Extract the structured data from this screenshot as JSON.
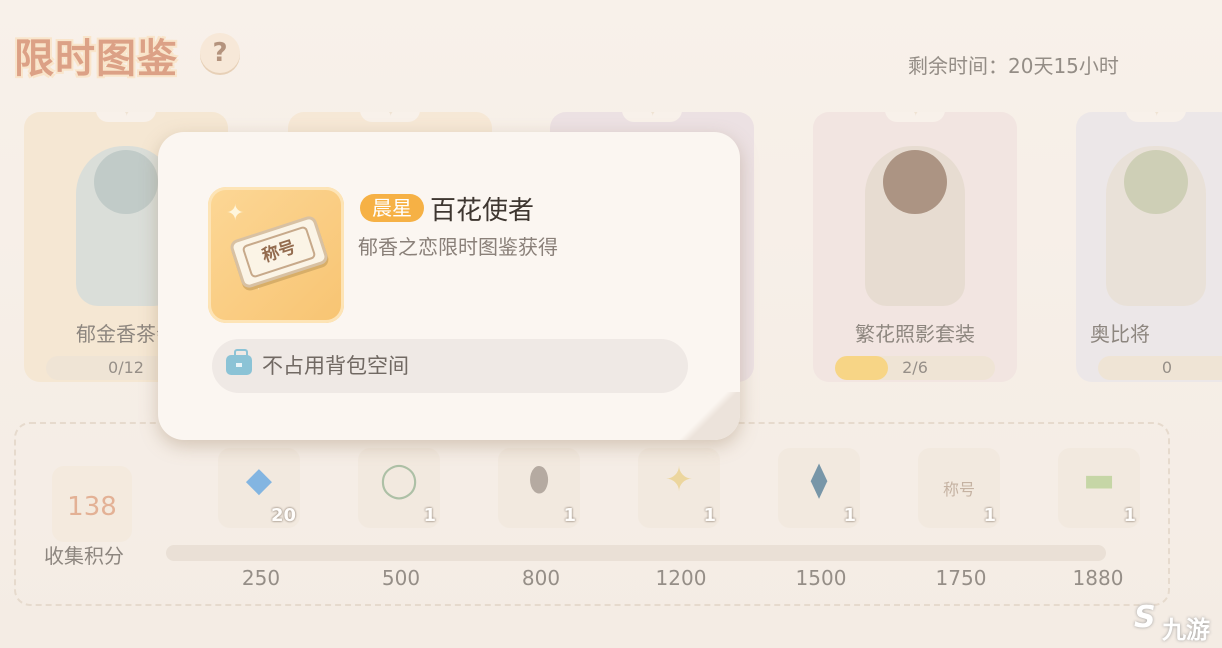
{
  "header": {
    "title": "限时图鉴",
    "help": "?",
    "timer": "剩余时间：20天15小时"
  },
  "cards": [
    {
      "name": "郁金香茶会",
      "progress_text": "0/12",
      "progress": 0
    },
    {
      "name": "",
      "progress_text": "",
      "progress": 0
    },
    {
      "name": "",
      "progress_text": "",
      "progress": 0
    },
    {
      "name": "繁花照影套装",
      "progress_text": "2/6",
      "progress": 0.333
    },
    {
      "name": "奥比将",
      "progress_text": "0",
      "progress": 0
    }
  ],
  "collection": {
    "score": "138",
    "score_label": "收集积分",
    "milestones": [
      "250",
      "500",
      "800",
      "1200",
      "1500",
      "1750",
      "1880"
    ],
    "rewards": [
      {
        "icon": "crystal-icon",
        "glyph": "◆",
        "color": "#3e8fd6",
        "count": "20"
      },
      {
        "icon": "wreath-icon",
        "glyph": "◯",
        "color": "#7fa07a",
        "count": "1"
      },
      {
        "icon": "egg-icon",
        "glyph": "⬮",
        "color": "#8b7d72",
        "count": "1"
      },
      {
        "icon": "gold-item-icon",
        "glyph": "✦",
        "color": "#e2c36e",
        "count": "1"
      },
      {
        "icon": "wings-icon",
        "glyph": "⧫",
        "color": "#2d5f7e",
        "count": "1"
      },
      {
        "icon": "title-ticket-icon",
        "glyph": "称号",
        "color": "#a48a74",
        "count": "1"
      },
      {
        "icon": "scenery-icon",
        "glyph": "▬",
        "color": "#a6c27a",
        "count": "1"
      }
    ]
  },
  "popup": {
    "icon_label": "称号",
    "rarity": "晨星",
    "item_name": "百花使者",
    "source": "郁香之恋限时图鉴获得",
    "note": "不占用背包空间"
  },
  "watermark": {
    "logo": "S",
    "text": "九游"
  }
}
